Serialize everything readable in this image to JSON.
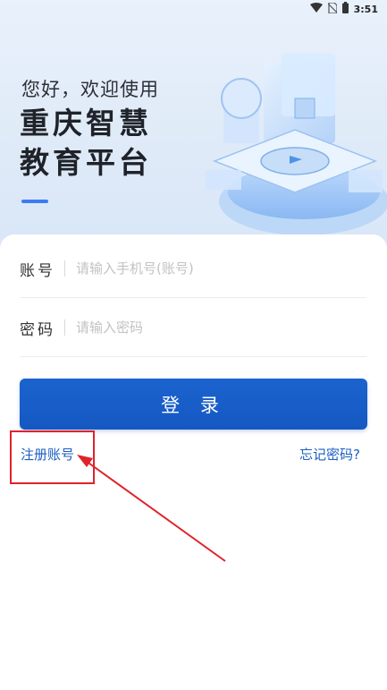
{
  "status_bar": {
    "time": "3:51",
    "icons": [
      "wifi-icon",
      "no-sim-icon",
      "battery-icon"
    ]
  },
  "header": {
    "greeting": "您好，欢迎使用",
    "app_title": "重庆智慧教育平台"
  },
  "form": {
    "account": {
      "label": "账号",
      "placeholder": "请输入手机号(账号)",
      "value": ""
    },
    "password": {
      "label": "密码",
      "placeholder": "请输入密码",
      "value": ""
    },
    "login_button": "登 录",
    "register_link": "注册账号",
    "forgot_link": "忘记密码?"
  },
  "colors": {
    "primary": "#1b63cf",
    "link": "#1b5fc2",
    "annotation": "#e0232b"
  }
}
